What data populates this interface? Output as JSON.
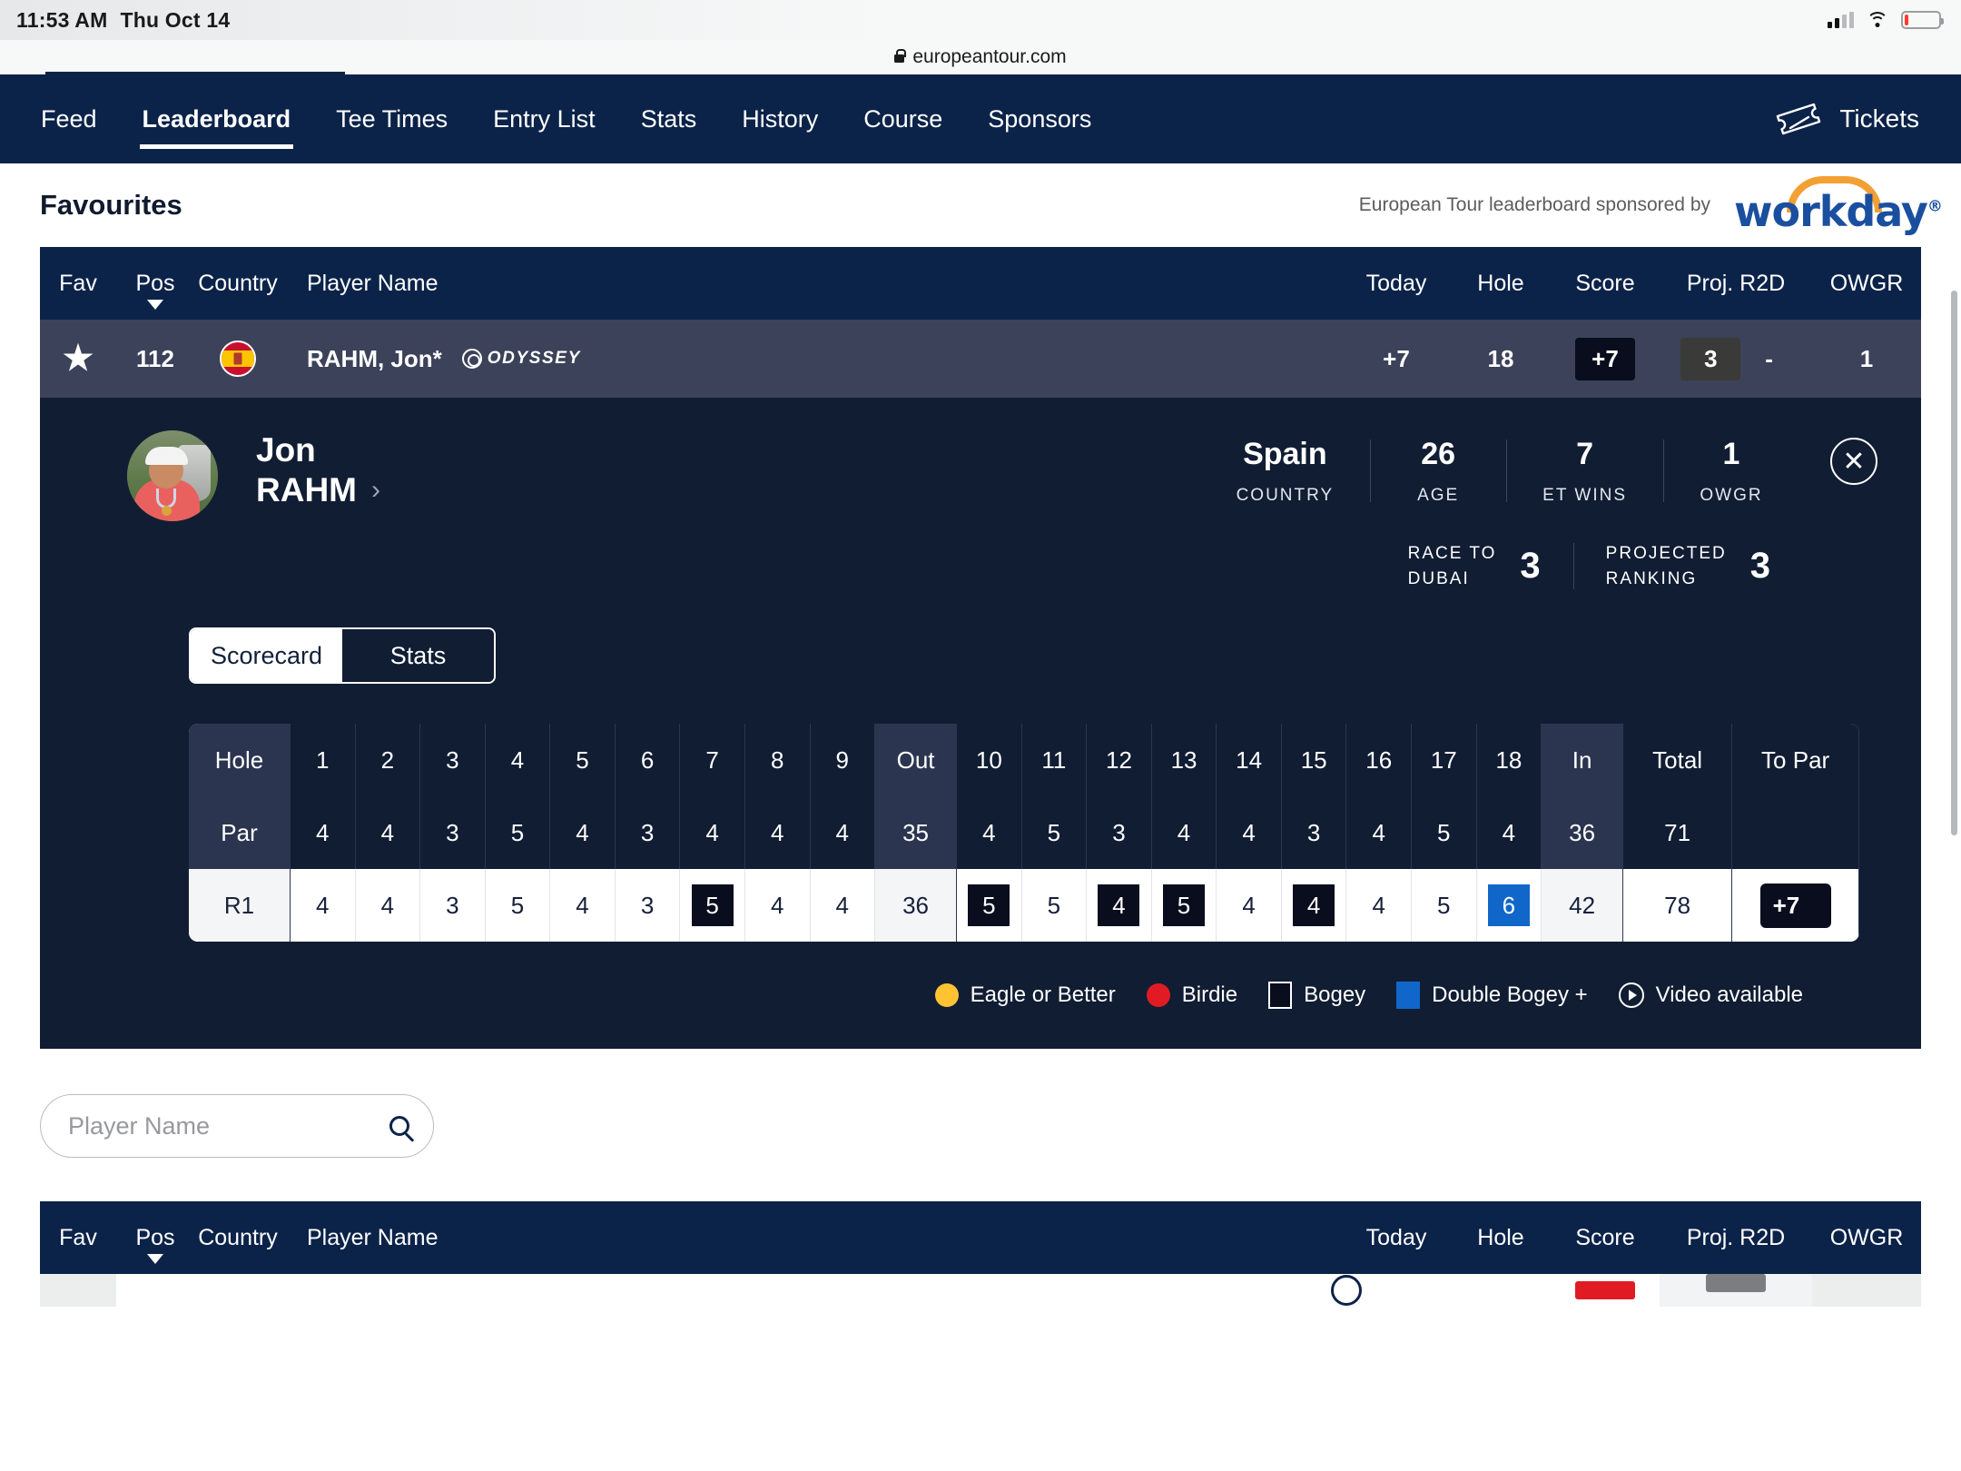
{
  "status_bar": {
    "time": "11:53 AM",
    "date": "Thu Oct 14",
    "signal_icon": "cellular-signal-icon",
    "wifi_icon": "wifi-icon",
    "battery_icon": "battery-low-icon"
  },
  "browser": {
    "url": "europeantour.com",
    "lock_icon": "lock-icon"
  },
  "nav": {
    "items": [
      {
        "label": "Feed",
        "active": false
      },
      {
        "label": "Leaderboard",
        "active": true
      },
      {
        "label": "Tee Times",
        "active": false
      },
      {
        "label": "Entry List",
        "active": false
      },
      {
        "label": "Stats",
        "active": false
      },
      {
        "label": "History",
        "active": false
      },
      {
        "label": "Course",
        "active": false
      },
      {
        "label": "Sponsors",
        "active": false
      }
    ],
    "tickets_label": "Tickets",
    "tickets_icon": "ticket-icon",
    "background_color": "#0c2349"
  },
  "page": {
    "section_title": "Favourites",
    "sponsor_text": "European Tour leaderboard sponsored by",
    "sponsor_logo_word": "workday",
    "sponsor_logo_mark": "®",
    "sponsor_arc_color": "#f2a033",
    "sponsor_word_color": "#1a4fa0"
  },
  "leaderboard": {
    "columns": {
      "fav": "Fav",
      "pos": "Pos",
      "country": "Country",
      "player_name": "Player Name",
      "today": "Today",
      "hole": "Hole",
      "score": "Score",
      "proj_r2d": "Proj. R2D",
      "owgr": "OWGR"
    },
    "sort_icon": "sort-descending-caret-icon",
    "row": {
      "fav_icon": "star-filled-icon",
      "pos": "112",
      "country_flag": "spain-flag-icon",
      "player_name": "RAHM, Jon*",
      "sponsor_brand": "ODYSSEY",
      "brand_icon": "odyssey-logo-icon",
      "today": "+7",
      "hole": "18",
      "score": "+7",
      "proj_r2d_badge": "3",
      "proj_r2d_change": "-",
      "owgr": "1"
    }
  },
  "player_detail": {
    "avatar_icon": "player-photo-avatar",
    "first_name": "Jon",
    "last_name": "RAHM",
    "chevron_icon": "chevron-right-icon",
    "close_icon": "close-circle-icon",
    "stats": [
      {
        "value": "Spain",
        "label": "COUNTRY"
      },
      {
        "value": "26",
        "label": "AGE"
      },
      {
        "value": "7",
        "label": "ET WINS"
      },
      {
        "value": "1",
        "label": "OWGR"
      }
    ],
    "rankings": [
      {
        "label": "RACE TO\nDUBAI",
        "label_line1": "RACE TO",
        "label_line2": "DUBAI",
        "value": "3"
      },
      {
        "label": "PROJECTED\nRANKING",
        "label_line1": "PROJECTED",
        "label_line2": "RANKING",
        "value": "3"
      }
    ],
    "toggle": {
      "scorecard_label": "Scorecard",
      "stats_label": "Stats",
      "selected": "Scorecard"
    }
  },
  "scorecard": {
    "row_labels": {
      "hole": "Hole",
      "par": "Par",
      "round": "R1"
    },
    "holes": [
      "1",
      "2",
      "3",
      "4",
      "5",
      "6",
      "7",
      "8",
      "9"
    ],
    "holes_back": [
      "10",
      "11",
      "12",
      "13",
      "14",
      "15",
      "16",
      "17",
      "18"
    ],
    "out_label": "Out",
    "in_label": "In",
    "total_label": "Total",
    "topar_label": "To Par",
    "par_front": [
      "4",
      "4",
      "3",
      "5",
      "4",
      "3",
      "4",
      "4",
      "4"
    ],
    "par_out": "35",
    "par_back": [
      "4",
      "5",
      "3",
      "4",
      "4",
      "3",
      "4",
      "5",
      "4"
    ],
    "par_in": "36",
    "par_total": "71",
    "par_topar": "",
    "r1_front": [
      {
        "value": "4",
        "mark": "par"
      },
      {
        "value": "4",
        "mark": "par"
      },
      {
        "value": "3",
        "mark": "par"
      },
      {
        "value": "5",
        "mark": "par"
      },
      {
        "value": "4",
        "mark": "par"
      },
      {
        "value": "3",
        "mark": "par"
      },
      {
        "value": "5",
        "mark": "bogey"
      },
      {
        "value": "4",
        "mark": "par"
      },
      {
        "value": "4",
        "mark": "par"
      }
    ],
    "r1_out": "36",
    "r1_back": [
      {
        "value": "5",
        "mark": "bogey"
      },
      {
        "value": "5",
        "mark": "par"
      },
      {
        "value": "4",
        "mark": "bogey"
      },
      {
        "value": "5",
        "mark": "bogey"
      },
      {
        "value": "4",
        "mark": "par"
      },
      {
        "value": "4",
        "mark": "bogey"
      },
      {
        "value": "4",
        "mark": "par"
      },
      {
        "value": "5",
        "mark": "par"
      },
      {
        "value": "6",
        "mark": "double"
      }
    ],
    "r1_in": "42",
    "r1_total": "78",
    "r1_topar": "+7"
  },
  "legend": [
    {
      "label": "Eagle or Better",
      "icon": "eagle-circle-icon",
      "color": "#ffc233"
    },
    {
      "label": "Birdie",
      "icon": "birdie-circle-icon",
      "color": "#e01b24"
    },
    {
      "label": "Bogey",
      "icon": "bogey-square-icon",
      "color": "#0a0d1d"
    },
    {
      "label": "Double Bogey +",
      "icon": "double-bogey-square-icon",
      "color": "#1167c9"
    },
    {
      "label": "Video available",
      "icon": "play-circle-icon",
      "color": "#ffffff"
    }
  ],
  "search": {
    "placeholder": "Player Name",
    "value": "",
    "icon": "search-icon"
  },
  "leaderboard_bottom": {
    "columns": {
      "fav": "Fav",
      "pos": "Pos",
      "country": "Country",
      "player_name": "Player Name",
      "today": "Today",
      "hole": "Hole",
      "score": "Score",
      "proj_r2d": "Proj. R2D",
      "owgr": "OWGR"
    },
    "sort_icon": "sort-descending-caret-icon"
  }
}
